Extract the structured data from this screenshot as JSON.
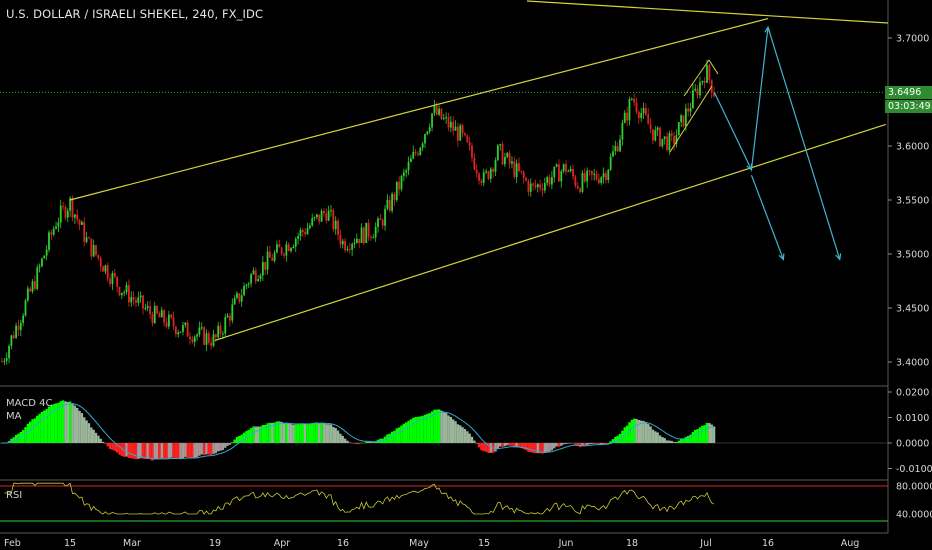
{
  "title": "U.S. DOLLAR / ISRAELI SHEKEL, 240, FX_IDC",
  "price_label": "3.6496",
  "timer_label": "03:03:49",
  "macd_label": "MACD 4C",
  "ma_label": "MA",
  "rsi_label": "RSI",
  "colors": {
    "up_candle": "#2fd12f",
    "down_candle": "#e02424",
    "channel": "#d4d43a",
    "projection": "#3fb6cf",
    "current_price_line": "#2ea82e",
    "macd_up_strong": "#00ff00",
    "macd_up_weak": "#9ab59a",
    "macd_down_strong": "#ff2020",
    "macd_down_weak": "#a89a9a",
    "macd_signal": "#33aacc",
    "rsi_line": "#c8c83a",
    "rsi_upper": "#e02424",
    "rsi_lower": "#2fd12f"
  },
  "chart_data": [
    {
      "type": "candlestick",
      "title": "U.S. DOLLAR / ISRAELI SHEKEL, 240, FX_IDC",
      "y_ticks": [
        "3.7000",
        "3.6500",
        "3.6000",
        "3.5500",
        "3.5000",
        "3.4500",
        "3.4000"
      ],
      "x_ticks": [
        "Feb",
        "15",
        "Mar",
        "19",
        "Apr",
        "16",
        "May",
        "15",
        "Jun",
        "18",
        "Jul",
        "16",
        "Aug"
      ],
      "ylim": [
        3.39,
        3.725
      ],
      "current_price": 3.6496,
      "price_path": [
        [
          "Feb",
          3.405
        ],
        [
          "Feb 8",
          3.48
        ],
        [
          "Feb 12",
          3.53
        ],
        [
          "Feb 15",
          3.548
        ],
        [
          "Feb 19",
          3.51
        ],
        [
          "Feb 26",
          3.47
        ],
        [
          "Mar 5",
          3.445
        ],
        [
          "Mar 12",
          3.43
        ],
        [
          "Mar 19",
          3.42
        ],
        [
          "Mar 26",
          3.48
        ],
        [
          "Apr",
          3.505
        ],
        [
          "Apr 9",
          3.53
        ],
        [
          "Apr 12",
          3.54
        ],
        [
          "Apr 16",
          3.51
        ],
        [
          "Apr 23",
          3.525
        ],
        [
          "May",
          3.6
        ],
        [
          "May 4",
          3.632
        ],
        [
          "May 10",
          3.61
        ],
        [
          "May 15",
          3.568
        ],
        [
          "May 18",
          3.595
        ],
        [
          "May 25",
          3.56
        ],
        [
          "Jun",
          3.58
        ],
        [
          "Jun 4",
          3.565
        ],
        [
          "Jun 11",
          3.575
        ],
        [
          "Jun 14",
          3.6
        ],
        [
          "Jun 18",
          3.645
        ],
        [
          "Jun 22",
          3.61
        ],
        [
          "Jun 25",
          3.602
        ],
        [
          "Jul",
          3.67
        ],
        [
          "Jul 3",
          3.65
        ]
      ],
      "channel": {
        "upper": [
          [
            "Feb 15",
            3.55
          ],
          [
            "Jul 16",
            3.718
          ]
        ],
        "lower": [
          [
            "Mar 19",
            3.42
          ],
          [
            "Aug 8",
            3.62
          ]
        ]
      },
      "projection_path": [
        [
          "Jul 3",
          3.65
        ],
        [
          "Jul 12",
          3.578
        ],
        [
          "Jul 16",
          3.71
        ],
        [
          "Jul 30",
          3.495
        ]
      ],
      "projection_alt": [
        [
          "Jul 12",
          3.573
        ],
        [
          "Jul 19",
          3.495
        ]
      ]
    },
    {
      "type": "histogram",
      "title": "MACD 4C",
      "y_ticks": [
        "0.0200",
        "0.0100",
        "0.0000",
        "-0.0100"
      ],
      "ylim": [
        -0.0135,
        0.0215
      ]
    },
    {
      "type": "line",
      "title": "RSI",
      "y_ticks": [
        "80.0000",
        "40.0000"
      ],
      "ylim": [
        20,
        88
      ],
      "levels": [
        80,
        30
      ]
    }
  ]
}
